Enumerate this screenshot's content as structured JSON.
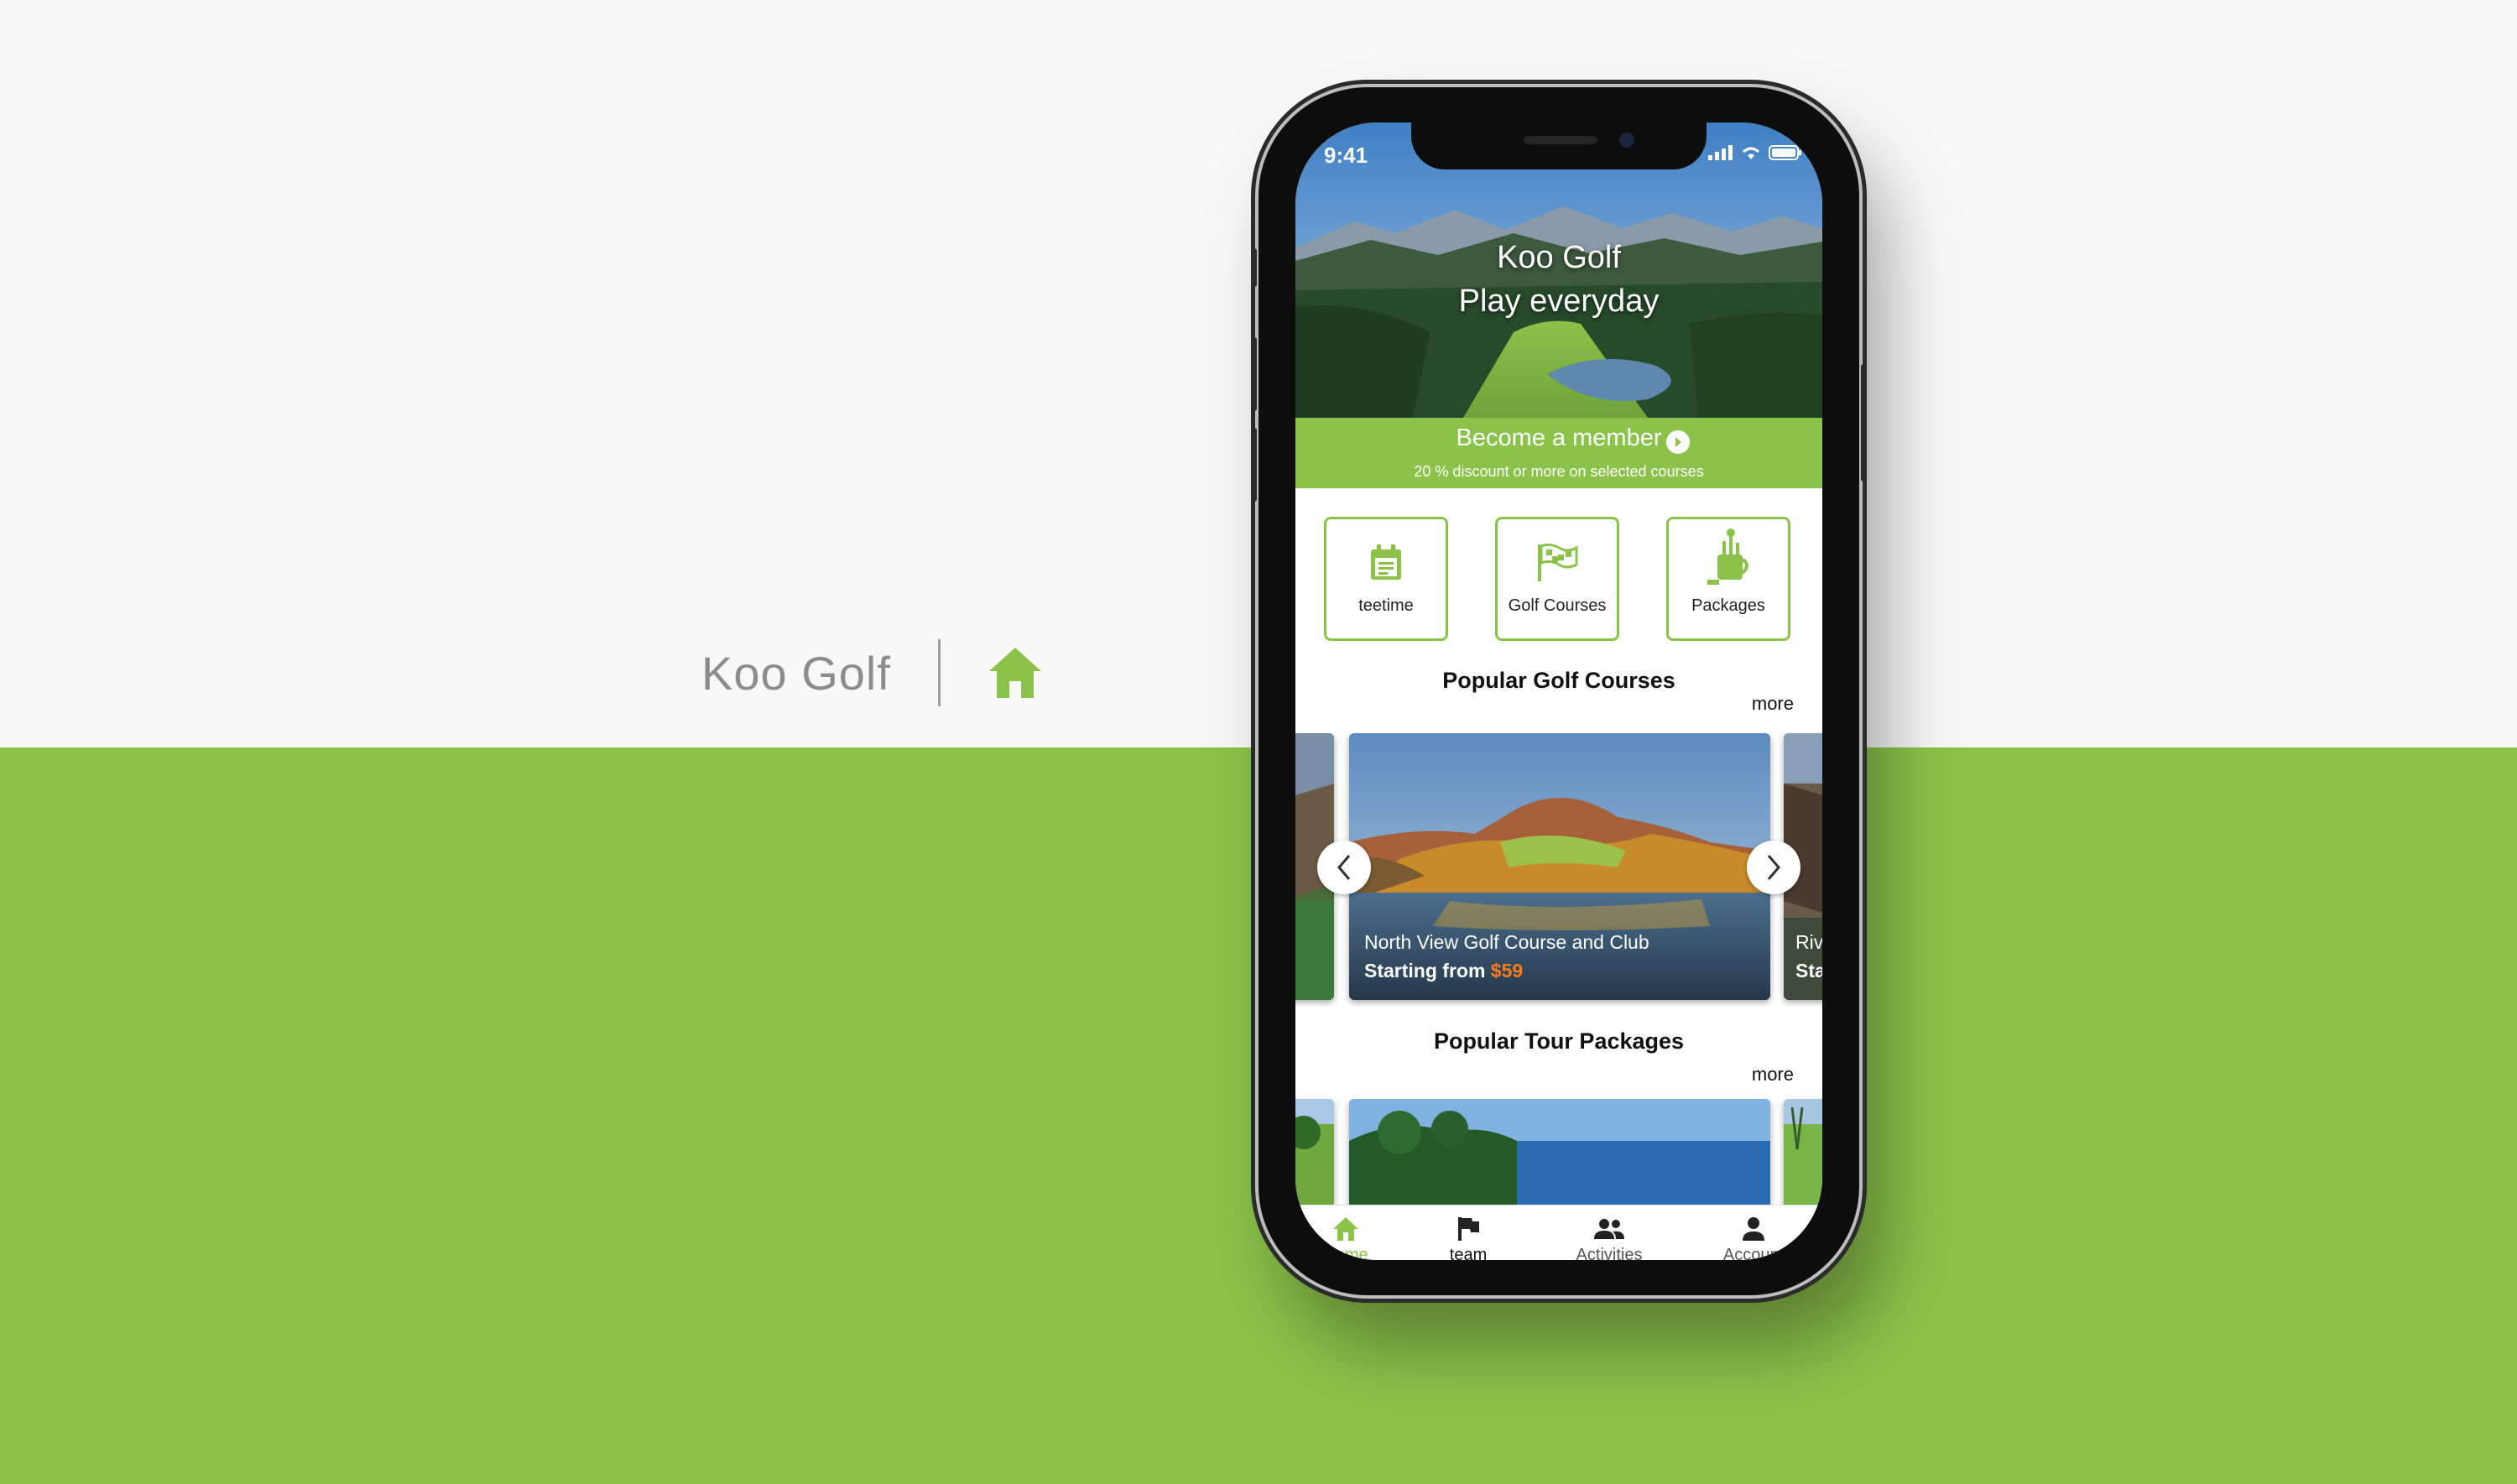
{
  "brand": {
    "name": "Koo Golf"
  },
  "status_bar": {
    "time": "9:41"
  },
  "hero": {
    "title": "Koo Golf",
    "tagline": "Play everyday"
  },
  "member": {
    "title": "Become a member",
    "subtitle": "20 % discount or more on selected courses"
  },
  "tiles": [
    {
      "label": "teetime",
      "icon": "calendar-icon"
    },
    {
      "label": "Golf Courses",
      "icon": "flag-icon"
    },
    {
      "label": "Packages",
      "icon": "golf-bag-icon"
    }
  ],
  "popular_courses": {
    "title": "Popular Golf Courses",
    "more": "more",
    "featured": {
      "name": "North View Golf Course and Club",
      "price_label": "Starting from",
      "price": "$59"
    },
    "next_peek": {
      "name": "Riv",
      "price_label": "Sta"
    }
  },
  "popular_packages": {
    "title": "Popular Tour Packages",
    "more": "more"
  },
  "tabbar": {
    "items": [
      {
        "label": "Home",
        "icon": "home-icon",
        "active": true
      },
      {
        "label": "team",
        "icon": "flag-icon",
        "active": false
      },
      {
        "label": "Activities",
        "icon": "people-icon",
        "active": false
      },
      {
        "label": "Account",
        "icon": "person-icon",
        "active": false
      }
    ]
  },
  "colors": {
    "accent": "#8bc34a",
    "price": "#ff7a1a"
  }
}
